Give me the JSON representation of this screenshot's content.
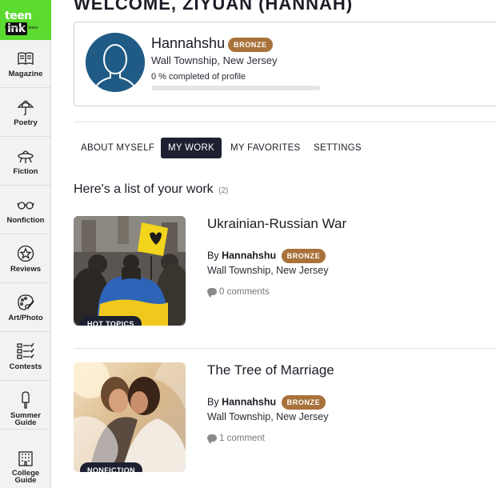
{
  "logo": {
    "main_text": "teen",
    "box_text": "ink",
    "tagline": "By teens, for teens"
  },
  "sidebar": {
    "items": [
      {
        "label": "Magazine",
        "icon": "book-icon"
      },
      {
        "label": "Poetry",
        "icon": "umbrella-icon"
      },
      {
        "label": "Fiction",
        "icon": "ufo-icon"
      },
      {
        "label": "Nonfiction",
        "icon": "glasses-icon"
      },
      {
        "label": "Reviews",
        "icon": "star-badge-icon"
      },
      {
        "label": "Art/Photo",
        "icon": "palette-icon"
      },
      {
        "label": "Contests",
        "icon": "checklist-icon"
      },
      {
        "label": "Summer",
        "label2": "Guide",
        "icon": "popsicle-icon"
      },
      {
        "label": "College",
        "label2": "Guide",
        "icon": "building-icon"
      }
    ]
  },
  "header": {
    "welcome": "WELCOME, ZIYUAN (HANNAH)"
  },
  "profile": {
    "username": "Hannahshu",
    "badge": "BRONZE",
    "location": "Wall Township, New Jersey",
    "progress_label": "0 % completed of profile",
    "progress_fraction": 0.0
  },
  "tabs": [
    {
      "label": "ABOUT MYSELF",
      "active": false
    },
    {
      "label": "MY WORK",
      "active": true
    },
    {
      "label": "MY FAVORITES",
      "active": false
    },
    {
      "label": "SETTINGS",
      "active": false
    }
  ],
  "list": {
    "heading": "Here's a list of your work",
    "count": "(2)"
  },
  "works": [
    {
      "title": "Ukrainian-Russian War",
      "by_prefix": "By",
      "author": "Hannahshu",
      "badge": "BRONZE",
      "location": "Wall Township, New Jersey",
      "comments": "0 comments",
      "tag": "HOT TOPICS"
    },
    {
      "title": "The Tree of Marriage",
      "by_prefix": "By",
      "author": "Hannahshu",
      "badge": "BRONZE",
      "location": "Wall Township, New Jersey",
      "comments": "1 comment",
      "tag": "NONFICTION"
    }
  ],
  "colors": {
    "accent_green": "#5bdb2f",
    "bronze": "#a8723a",
    "dark_navy": "#1c2030"
  }
}
